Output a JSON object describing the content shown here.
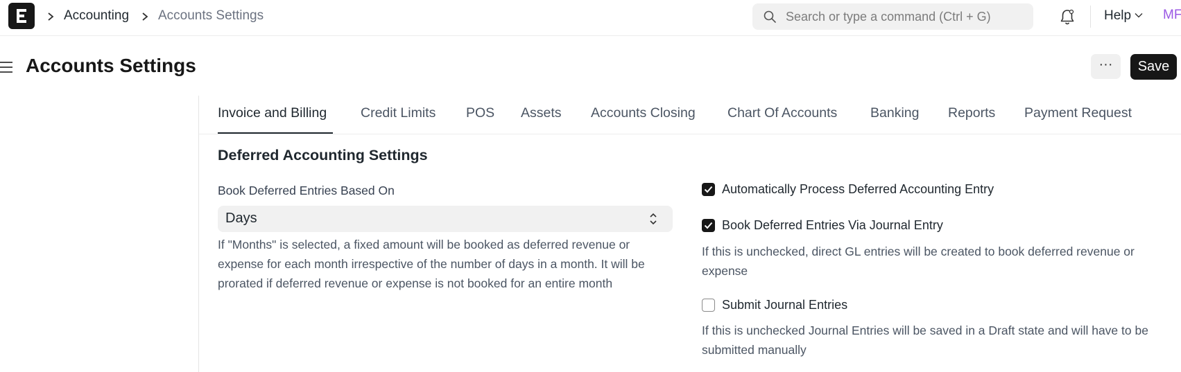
{
  "navbar": {
    "breadcrumbs": [
      "Accounting",
      "Accounts Settings"
    ],
    "search_placeholder": "Search or type a command (Ctrl + G)",
    "help_label": "Help",
    "avatar_initials": "MF"
  },
  "page": {
    "title": "Accounts Settings",
    "more_label": "···",
    "save_label": "Save"
  },
  "tabs": [
    {
      "label": "Invoice and Billing",
      "active": true
    },
    {
      "label": "Credit Limits"
    },
    {
      "label": "POS"
    },
    {
      "label": "Assets"
    },
    {
      "label": "Accounts Closing"
    },
    {
      "label": "Chart Of Accounts"
    },
    {
      "label": "Banking"
    },
    {
      "label": "Reports"
    },
    {
      "label": "Payment Request"
    }
  ],
  "section": {
    "title": "Deferred Accounting Settings",
    "book_based_on": {
      "label": "Book Deferred Entries Based On",
      "value": "Days",
      "description": "If \"Months\" is selected, a fixed amount will be booked as deferred revenue or expense for each month irrespective of the number of days in a month. It will be prorated if deferred revenue or expense is not booked for an entire month"
    },
    "checkboxes": [
      {
        "label": "Automatically Process Deferred Accounting Entry",
        "checked": true
      },
      {
        "label": "Book Deferred Entries Via Journal Entry",
        "checked": true,
        "description": "If this is unchecked, direct GL entries will be created to book deferred revenue or expense"
      },
      {
        "label": "Submit Journal Entries",
        "checked": false,
        "description": "If this is unchecked Journal Entries will be saved in a Draft state and will have to be submitted manually"
      }
    ]
  },
  "colors": {
    "accent": "#171717",
    "avatar": "#9b59e4"
  }
}
